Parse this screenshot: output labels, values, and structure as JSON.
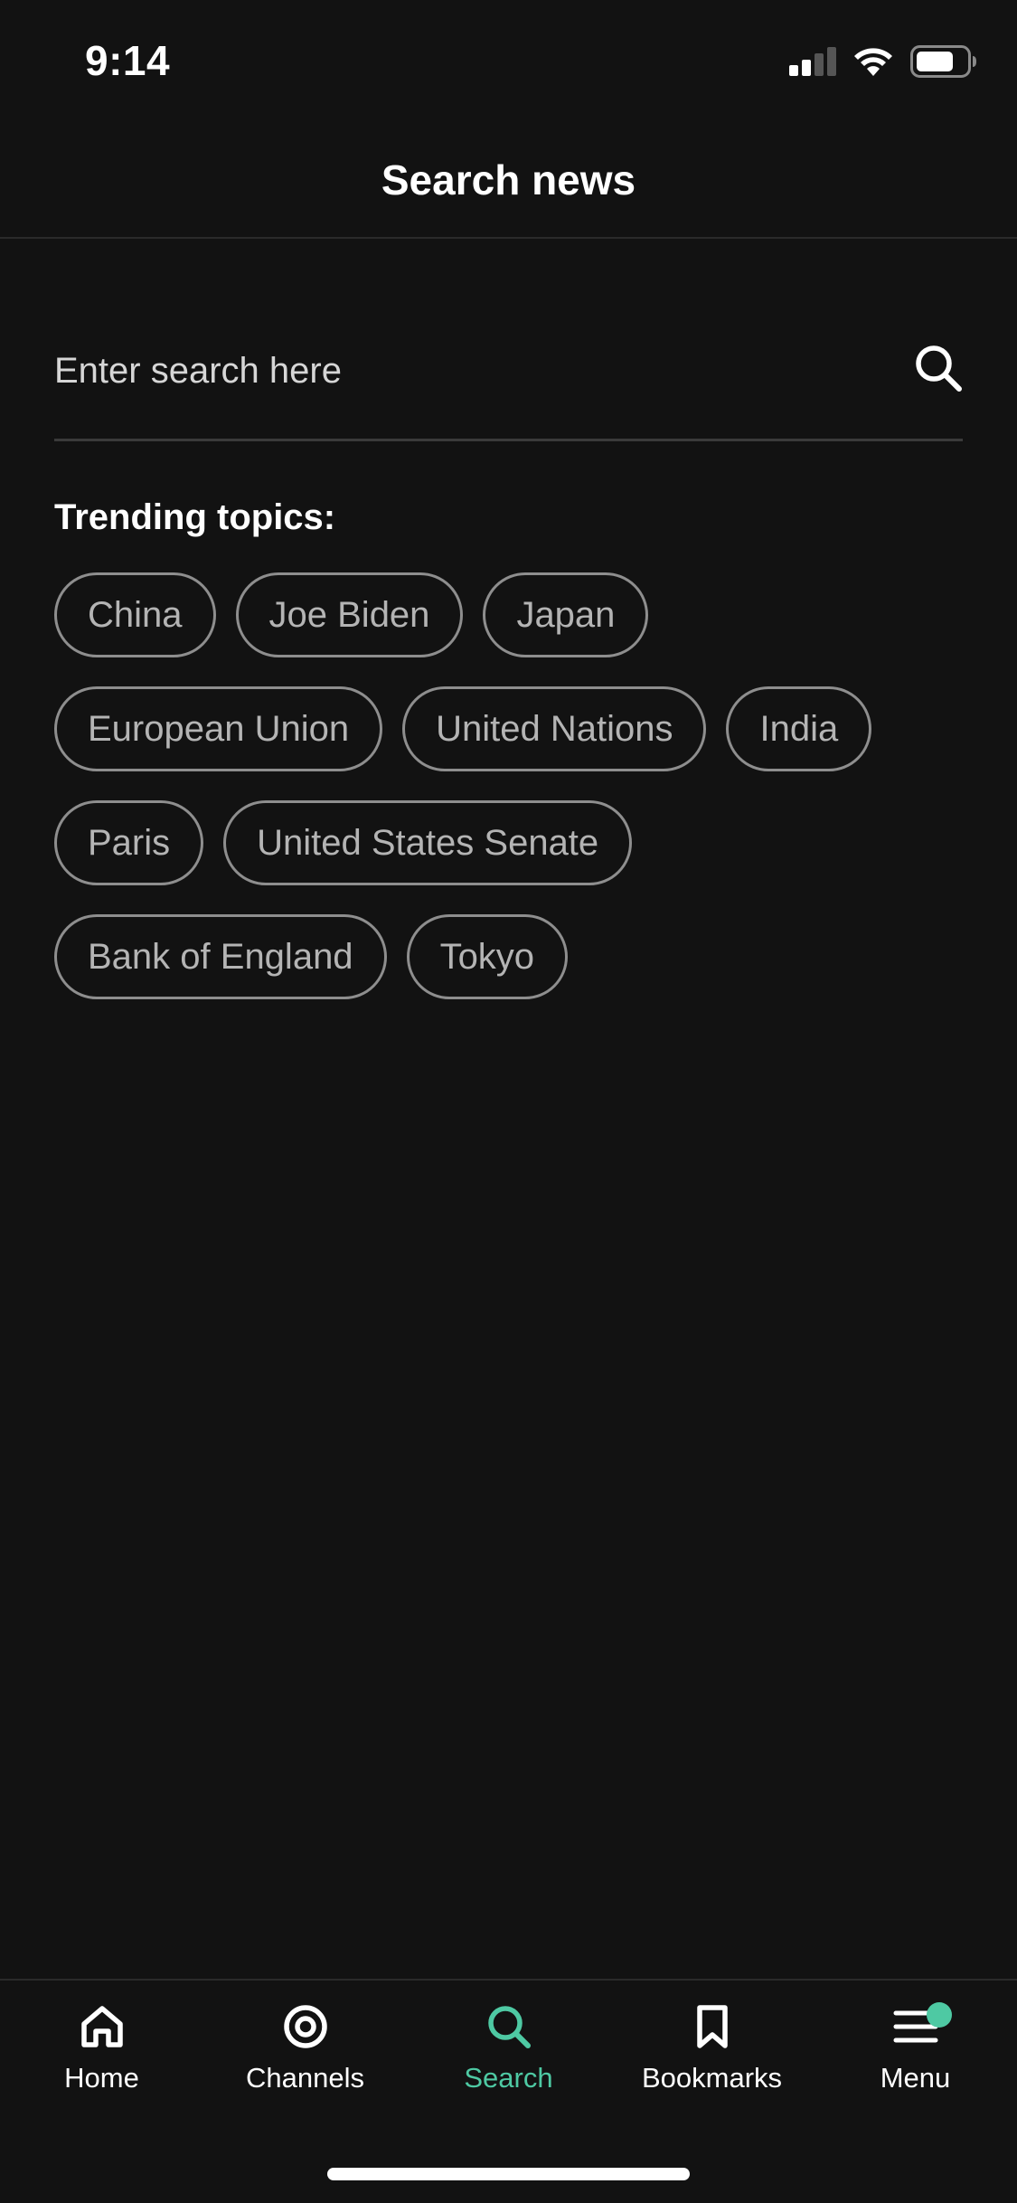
{
  "status_bar": {
    "time": "9:14"
  },
  "header": {
    "title": "Search news"
  },
  "search": {
    "placeholder": "Enter search here",
    "value": ""
  },
  "trending": {
    "title": "Trending topics:",
    "topics": [
      "China",
      "Joe Biden",
      "Japan",
      "European Union",
      "United Nations",
      "India",
      "Paris",
      "United States Senate",
      "Bank of England",
      "Tokyo"
    ]
  },
  "tabbar": {
    "tabs": [
      {
        "label": "Home",
        "icon": "home-icon"
      },
      {
        "label": "Channels",
        "icon": "target-icon"
      },
      {
        "label": "Search",
        "icon": "search-icon",
        "active": true
      },
      {
        "label": "Bookmarks",
        "icon": "bookmark-icon"
      },
      {
        "label": "Menu",
        "icon": "menu-icon",
        "badge": true
      }
    ]
  },
  "colors": {
    "background": "#121212",
    "accent": "#4ec9a3",
    "chip_border": "#8e8e8e",
    "chip_text": "#b4b4b4"
  }
}
